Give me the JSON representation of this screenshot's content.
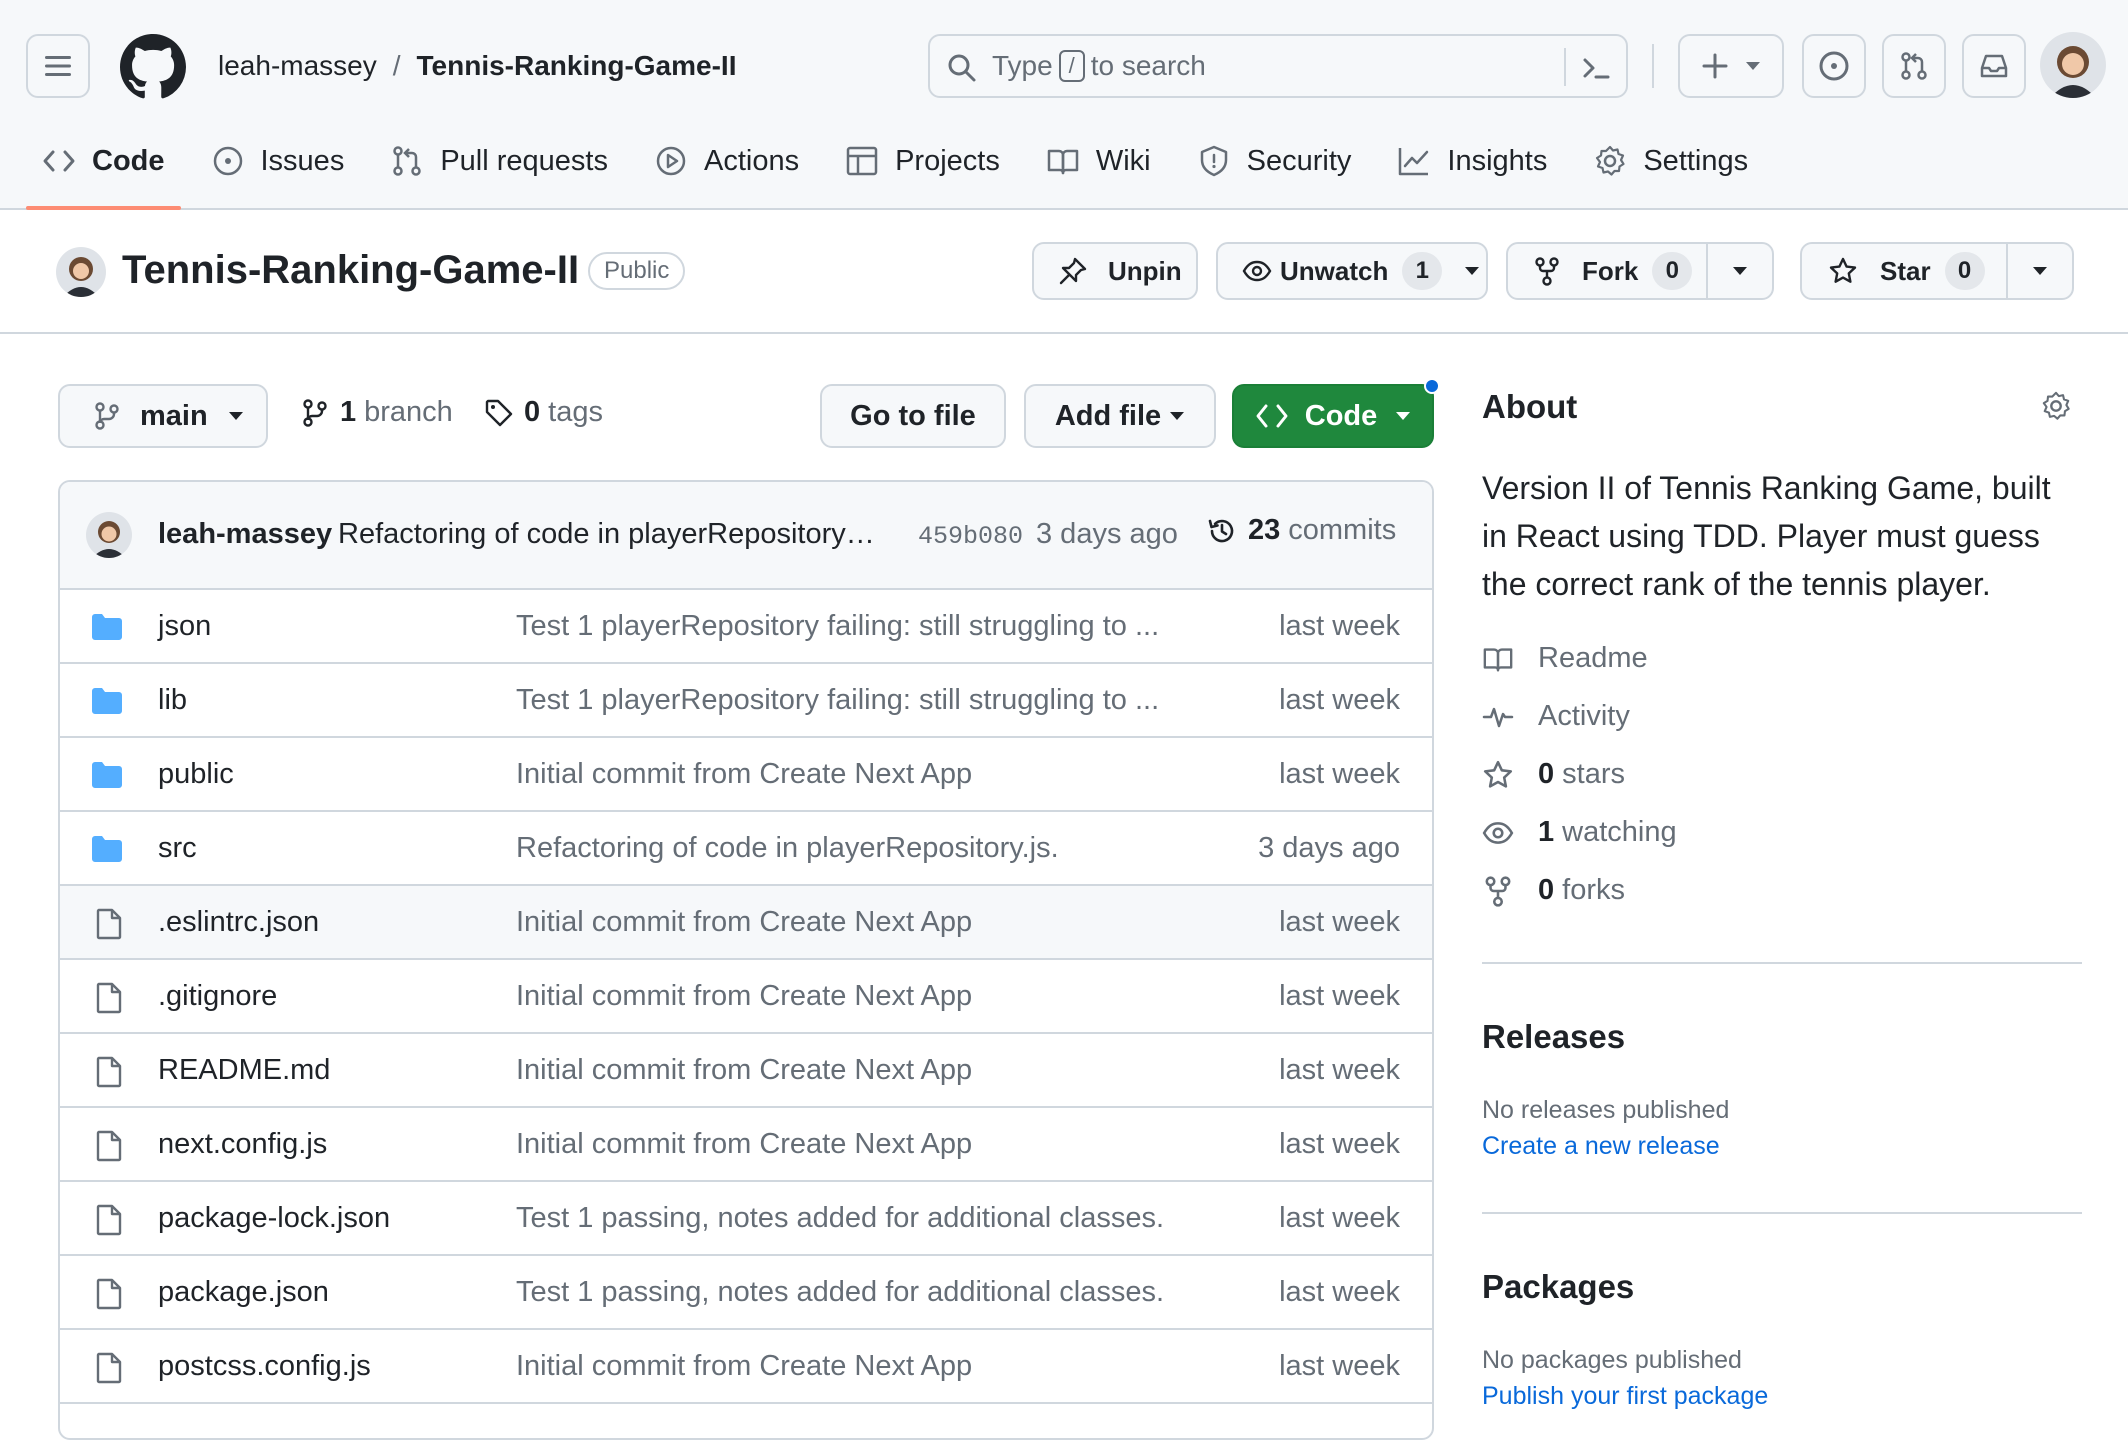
{
  "header": {
    "owner": "leah-massey",
    "separator": "/",
    "repo": "Tennis-Ranking-Game-II",
    "search": {
      "prefix": "Type",
      "key": "/",
      "suffix": "to search"
    }
  },
  "repo_nav": [
    {
      "label": "Code",
      "icon": "code-icon",
      "active": true
    },
    {
      "label": "Issues",
      "icon": "issue-icon"
    },
    {
      "label": "Pull requests",
      "icon": "pull-request-icon"
    },
    {
      "label": "Actions",
      "icon": "play-icon"
    },
    {
      "label": "Projects",
      "icon": "table-icon"
    },
    {
      "label": "Wiki",
      "icon": "book-icon"
    },
    {
      "label": "Security",
      "icon": "shield-icon"
    },
    {
      "label": "Insights",
      "icon": "graph-icon"
    },
    {
      "label": "Settings",
      "icon": "gear-icon"
    }
  ],
  "title_bar": {
    "repo_name": "Tennis-Ranking-Game-II",
    "visibility": "Public",
    "unpin_label": "Unpin",
    "unwatch_label": "Unwatch",
    "watch_count": "1",
    "fork_label": "Fork",
    "fork_count": "0",
    "star_label": "Star",
    "star_count": "0"
  },
  "toolbar": {
    "branch": "main",
    "branch_count": "1",
    "branch_label": "branch",
    "tag_count": "0",
    "tag_label": "tags",
    "go_to_file": "Go to file",
    "add_file": "Add file",
    "code": "Code"
  },
  "latest_commit": {
    "author": "leah-massey",
    "message": "Refactoring of code in playerRepository…",
    "sha": "459b080",
    "time": "3 days ago",
    "commit_count": "23",
    "commit_label": "commits"
  },
  "files": [
    {
      "name": "json",
      "type": "dir",
      "message": "Test 1 playerRepository failing: still struggling to ...",
      "time": "last week"
    },
    {
      "name": "lib",
      "type": "dir",
      "message": "Test 1 playerRepository failing: still struggling to ...",
      "time": "last week"
    },
    {
      "name": "public",
      "type": "dir",
      "message": "Initial commit from Create Next App",
      "time": "last week"
    },
    {
      "name": "src",
      "type": "dir",
      "message": "Refactoring of code in playerRepository.js.",
      "time": "3 days ago"
    },
    {
      "name": ".eslintrc.json",
      "type": "file",
      "message": "Initial commit from Create Next App",
      "time": "last week"
    },
    {
      "name": ".gitignore",
      "type": "file",
      "message": "Initial commit from Create Next App",
      "time": "last week"
    },
    {
      "name": "README.md",
      "type": "file",
      "message": "Initial commit from Create Next App",
      "time": "last week"
    },
    {
      "name": "next.config.js",
      "type": "file",
      "message": "Initial commit from Create Next App",
      "time": "last week"
    },
    {
      "name": "package-lock.json",
      "type": "file",
      "message": "Test 1 passing, notes added for additional classes.",
      "time": "last week"
    },
    {
      "name": "package.json",
      "type": "file",
      "message": "Test 1 passing, notes added for additional classes.",
      "time": "last week"
    },
    {
      "name": "postcss.config.js",
      "type": "file",
      "message": "Initial commit from Create Next App",
      "time": "last week"
    }
  ],
  "about": {
    "heading": "About",
    "description": "Version II of Tennis Ranking Game, built in React using TDD. Player must guess the correct rank of the tennis player.",
    "readme": "Readme",
    "activity": "Activity",
    "stars_count": "0",
    "stars_label": "stars",
    "watching_count": "1",
    "watching_label": "watching",
    "forks_count": "0",
    "forks_label": "forks"
  },
  "releases": {
    "heading": "Releases",
    "empty": "No releases published",
    "link": "Create a new release"
  },
  "packages": {
    "heading": "Packages",
    "empty": "No packages published",
    "link": "Publish your first package"
  },
  "colors": {
    "accent_green": "#1f883d",
    "link_blue": "#0969da",
    "folder_blue": "#54aeff",
    "tab_underline": "#fd8c73",
    "border": "#d0d7de",
    "muted_text": "#656d76"
  }
}
